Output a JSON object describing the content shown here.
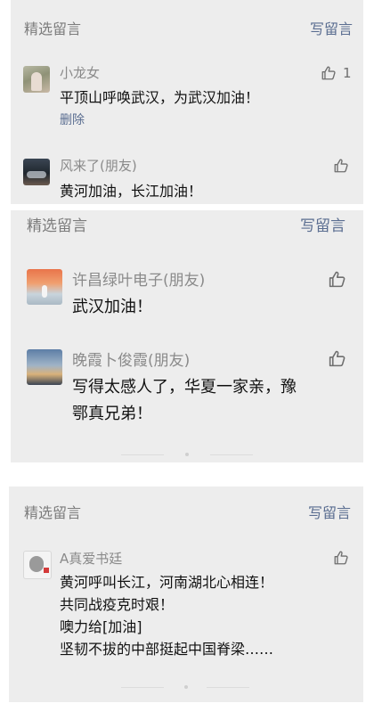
{
  "panels": [
    {
      "title": "精选留言",
      "write": "写留言",
      "comments": [
        {
          "name": "小龙女",
          "text": [
            "平顶山呼唤武汉，为武汉加油！"
          ],
          "delete": "删除",
          "likes": "1"
        },
        {
          "name": "风来了(朋友)",
          "text": [
            "黄河加油，长江加油！"
          ]
        }
      ]
    },
    {
      "title": "精选留言",
      "write": "写留言",
      "comments": [
        {
          "name": "许昌绿叶电子(朋友)",
          "text": [
            "武汉加油！"
          ]
        },
        {
          "name": "晚霞卜俊霞(朋友)",
          "text": [
            "写得太感人了，华夏一家亲，豫",
            "鄂真兄弟！"
          ]
        }
      ]
    },
    {
      "title": "精选留言",
      "write": "写留言",
      "comments": [
        {
          "name": "A真爱书廷",
          "text": [
            "黄河呼叫长江，河南湖北心相连！",
            "共同战疫克时艰！",
            "噢力给[加油]",
            "坚韧不拔的中部挺起中国脊梁……"
          ]
        }
      ]
    }
  ],
  "icons": {
    "like": "thumbs-up-icon"
  },
  "colors": {
    "panel_bg": "#ededed",
    "link": "#5b6e91",
    "name": "#8a8a8a",
    "text": "#111111"
  }
}
